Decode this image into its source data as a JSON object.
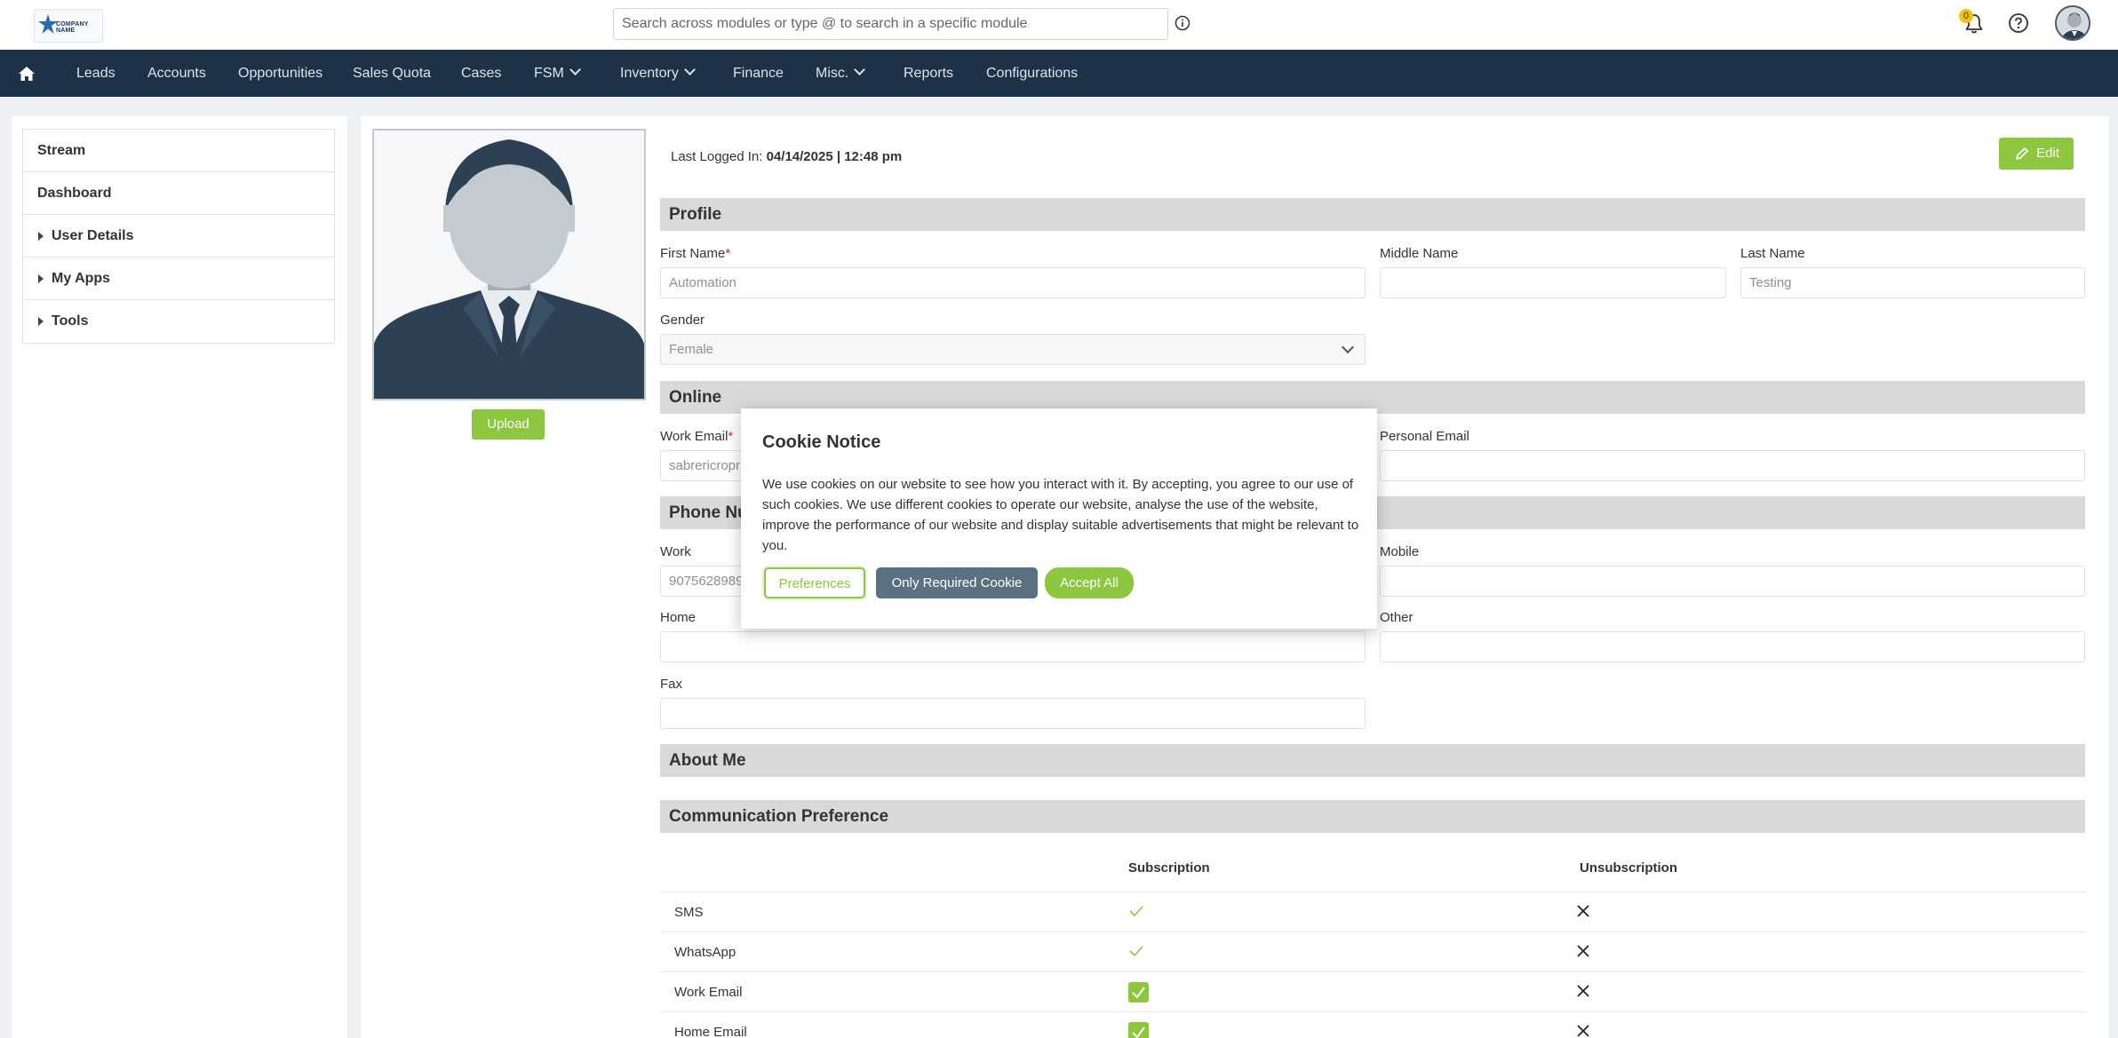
{
  "header": {
    "logo_text": "COMPANY NAME",
    "search_placeholder": "Search across modules or type @ to search in a specific module",
    "notification_count": "0"
  },
  "nav": {
    "items": [
      {
        "label": "Leads"
      },
      {
        "label": "Accounts"
      },
      {
        "label": "Opportunities"
      },
      {
        "label": "Sales Quota"
      },
      {
        "label": "Cases"
      },
      {
        "label": "FSM"
      },
      {
        "label": "Inventory"
      },
      {
        "label": "Finance"
      },
      {
        "label": "Misc."
      },
      {
        "label": "Reports"
      },
      {
        "label": "Configurations"
      }
    ]
  },
  "sidebar": {
    "items": [
      {
        "label": "Stream"
      },
      {
        "label": "Dashboard"
      },
      {
        "label": "User Details"
      },
      {
        "label": "My Apps"
      },
      {
        "label": "Tools"
      }
    ]
  },
  "profile": {
    "upload_label": "Upload",
    "last_logged_label": "Last Logged In: ",
    "last_logged_value": "04/14/2025 | 12:48 pm",
    "edit_label": "Edit"
  },
  "sections": {
    "profile": "Profile",
    "online": "Online",
    "phone": "Phone Numbers",
    "about": "About Me",
    "comm": "Communication Preference"
  },
  "fields": {
    "first_name_label": "First Name",
    "first_name_value": "Automation",
    "middle_name_label": "Middle Name",
    "middle_name_value": "",
    "last_name_label": "Last Name",
    "last_name_value": "Testing",
    "gender_label": "Gender",
    "gender_value": "Female",
    "work_email_label": "Work Email",
    "work_email_value": "sabrericropr",
    "personal_email_label": "Personal Email",
    "personal_email_value": "",
    "work_phone_label": "Work",
    "work_phone_value": "9075628989",
    "mobile_label": "Mobile",
    "mobile_value": "",
    "home_label": "Home",
    "home_value": "",
    "other_label": "Other",
    "other_value": "",
    "fax_label": "Fax",
    "fax_value": ""
  },
  "comm_table": {
    "col_subscription": "Subscription",
    "col_unsubscription": "Unsubscription",
    "rows": [
      {
        "name": "SMS"
      },
      {
        "name": "WhatsApp"
      },
      {
        "name": "Work Email"
      },
      {
        "name": "Home Email"
      }
    ]
  },
  "cookie": {
    "title": "Cookie Notice",
    "text": "We use cookies on our website to see how you interact with it. By accepting, you agree to our use of such cookies. We use different cookies to operate our website, analyse the use of the website, improve the performance of our website and display suitable advertisements that might be relevant to you.",
    "preferences": "Preferences",
    "only_required": "Only Required Cookie",
    "accept_all": "Accept All"
  },
  "colors": {
    "nav_bg": "#1e3247",
    "accent_green": "#8dc63f",
    "section_bg": "#d9d9d9",
    "secondary_btn": "#5a7083"
  }
}
